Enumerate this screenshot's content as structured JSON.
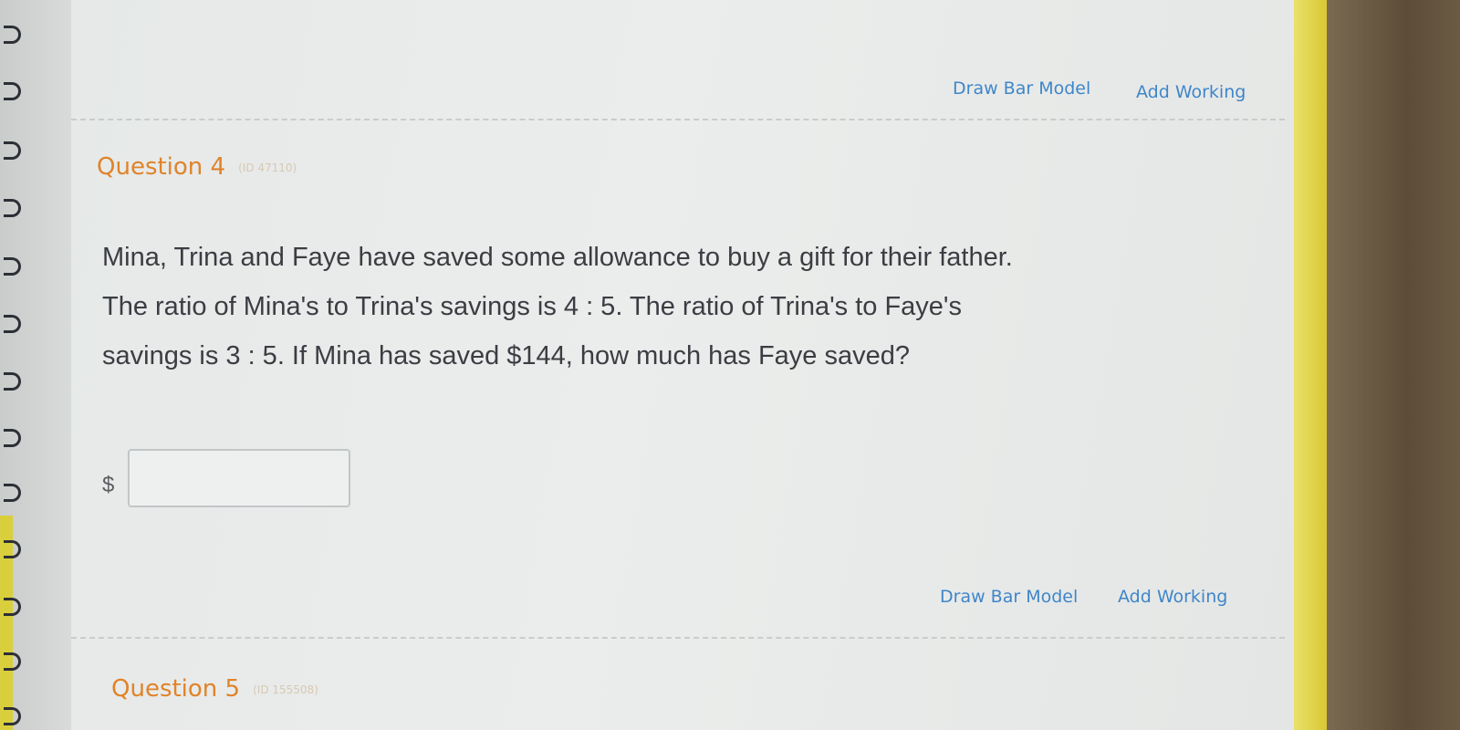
{
  "question4": {
    "links": {
      "draw_bar_model": "Draw Bar Model",
      "add_working": "Add Working"
    },
    "title": "Question 4",
    "id": "(ID 47110)",
    "text_lines": [
      "Mina, Trina and Faye have saved some allowance to buy a gift for their father.",
      "The ratio of Mina's to Trina's savings is 4 : 5. The ratio of Trina's to Faye's",
      "savings is 3 : 5. If Mina has saved $144, how much has Faye saved?"
    ],
    "answer": {
      "currency": "$",
      "value": ""
    }
  },
  "question5": {
    "links": {
      "draw_bar_model": "Draw Bar Model",
      "add_working": "Add Working"
    },
    "title": "Question 5",
    "id": "(ID 155508)"
  },
  "colors": {
    "link": "#3f86c9",
    "question_title": "#e0832a",
    "body_text": "#3b3d42"
  }
}
